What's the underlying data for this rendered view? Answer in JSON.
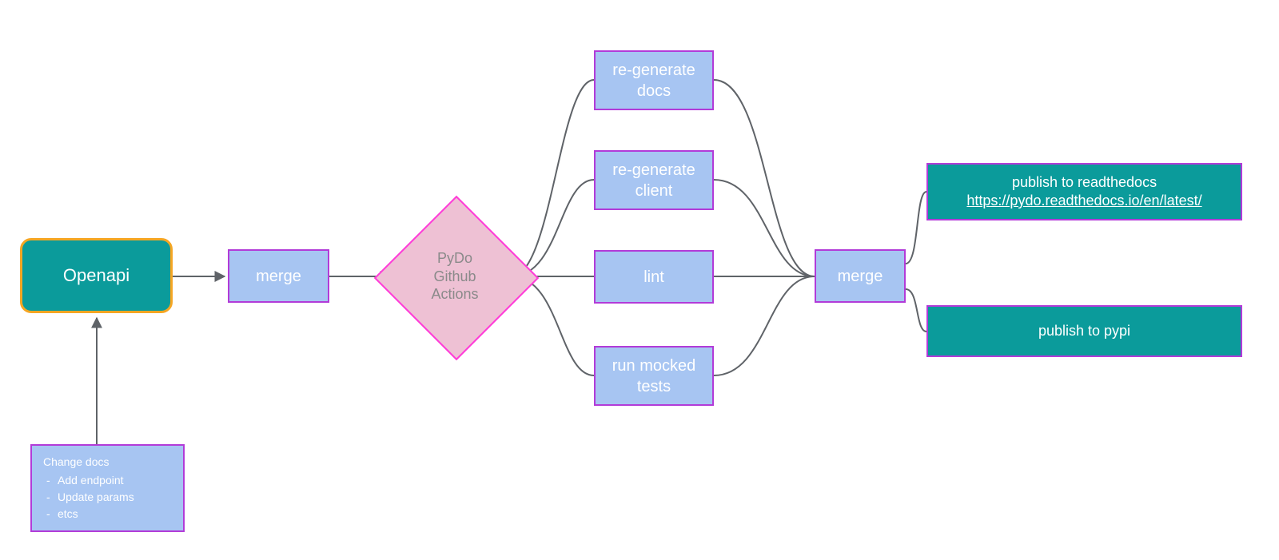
{
  "nodes": {
    "openapi": "Openapi",
    "merge1": "merge",
    "decision": "PyDo\nGithub\nActions",
    "regen_docs": "re-generate\ndocs",
    "regen_client": "re-generate\nclient",
    "lint": "lint",
    "run_mocked": "run mocked\ntests",
    "merge2": "merge",
    "publish_readthedocs_line1": "publish to readthedocs",
    "publish_readthedocs_link": "https://pydo.readthedocs.io/en/latest/",
    "publish_pypi": "publish to pypi"
  },
  "docs_box": {
    "title": "Change docs",
    "items": [
      "Add endpoint",
      "Update params",
      "etcs"
    ]
  },
  "colors": {
    "teal": "#0b9b9b",
    "orange": "#f5a623",
    "blue": "#a7c5f2",
    "purple": "#b23bd8",
    "pink_fill": "#eec1d4",
    "pink_border": "#ff3bd8",
    "edge": "#5f6368"
  }
}
